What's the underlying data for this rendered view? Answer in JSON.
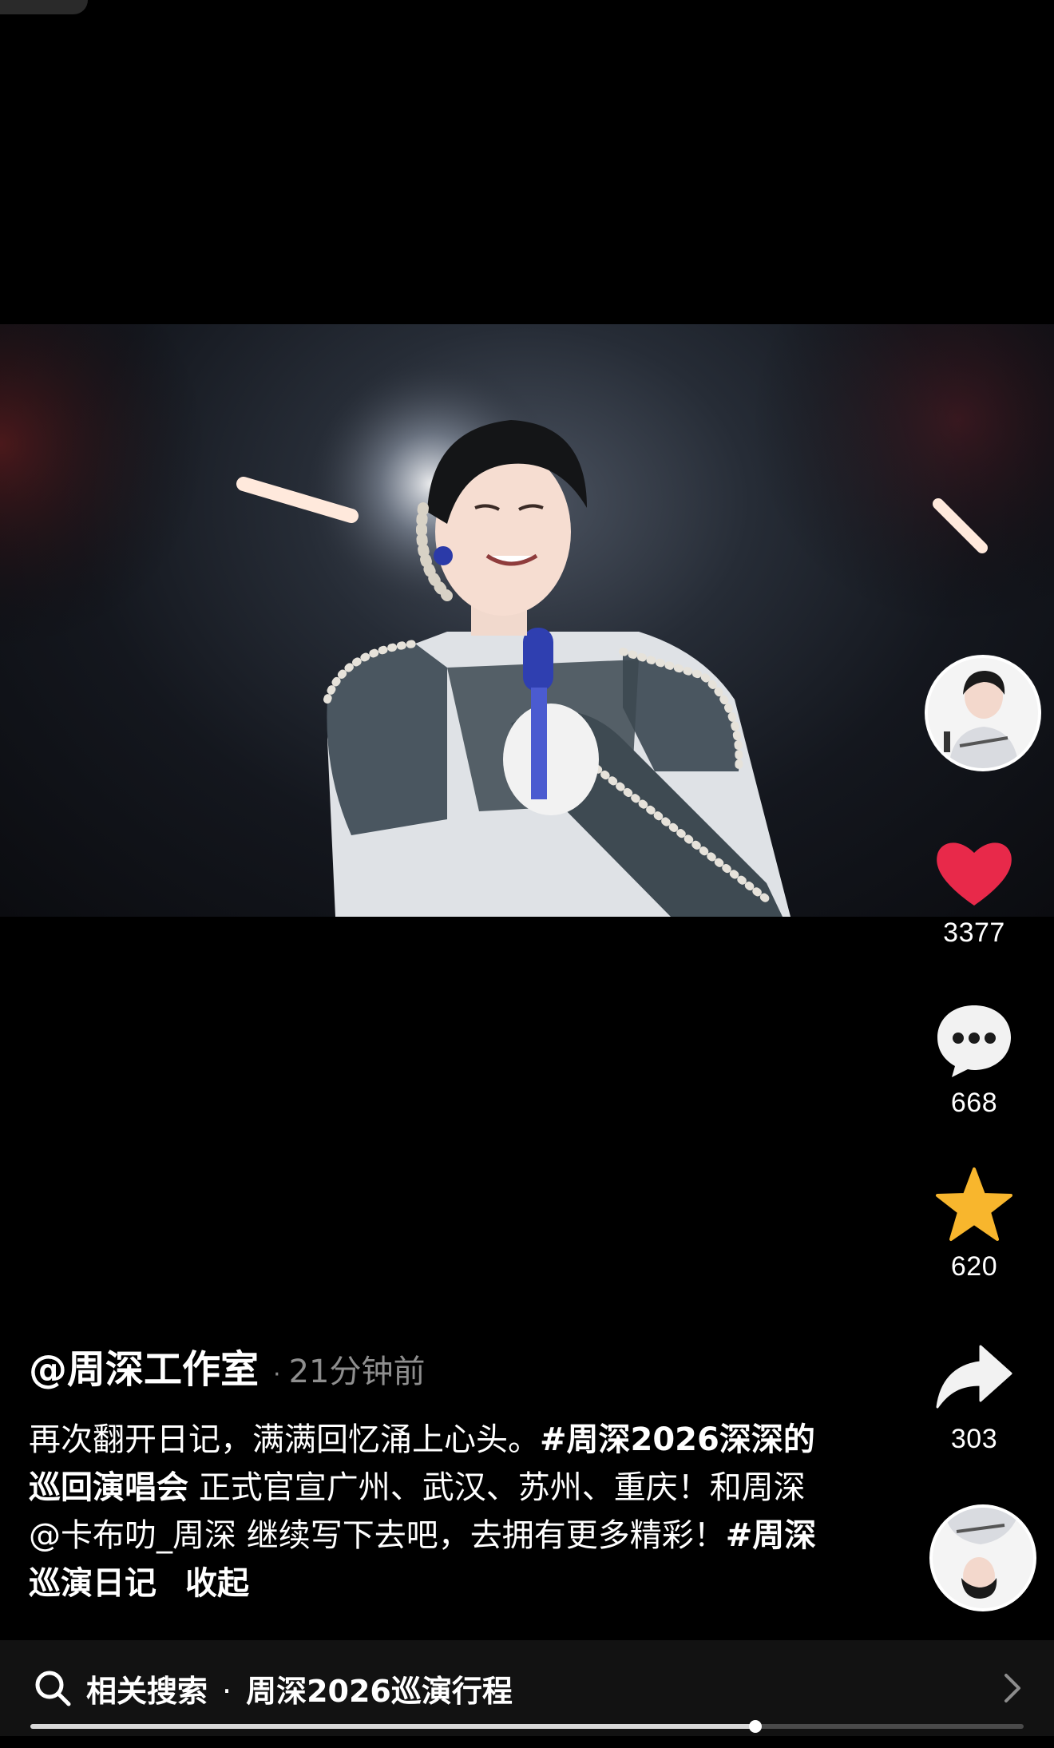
{
  "video": {
    "description_icon": "concert-performer-image"
  },
  "side_actions": {
    "author_avatar_icon": "profile-avatar-icon",
    "like": {
      "icon": "heart-icon",
      "count": "3377",
      "color": "#e8294a"
    },
    "comment": {
      "icon": "comment-bubble-icon",
      "count": "668"
    },
    "favorite": {
      "icon": "star-icon",
      "count": "620",
      "color": "#f8b62d"
    },
    "share": {
      "icon": "share-arrow-icon",
      "count": "303"
    },
    "music_disc_icon": "music-disc-avatar-icon"
  },
  "post": {
    "author": "@周深工作室",
    "separator": "·",
    "time": "21分钟前",
    "caption_part1": "再次翻开日记，满满回忆涌上心头。",
    "tag1": "#周深2026深深的巡回演唱会",
    "caption_part2": " 正式官宣广州、武汉、苏州、重庆！和周深@卡布叻_周深 继续写下去吧，去拥有更多精彩！",
    "tag2": "#周深巡演日记",
    "collapse_label": "收起"
  },
  "search": {
    "label": "相关搜索",
    "separator": "·",
    "query": "周深2026巡演行程"
  },
  "playback": {
    "progress_fraction": 0.73
  }
}
